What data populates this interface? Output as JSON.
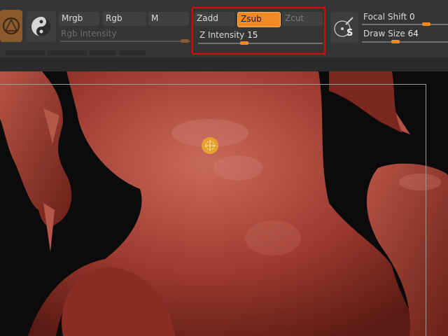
{
  "toolbar": {
    "rgb_mode_buttons": [
      "Mrgb",
      "Rgb",
      "M"
    ],
    "rgb_intensity_label": "Rgb Intensity",
    "zmode_buttons": {
      "zadd": "Zadd",
      "zsub": "Zsub",
      "zcut": "Zcut"
    },
    "active_zmode": "Zsub",
    "z_intensity": {
      "label": "Z Intensity",
      "value": "15"
    },
    "focal_shift": {
      "label": "Focal Shift",
      "value": "0"
    },
    "draw_size": {
      "label": "Draw Size",
      "value": "64"
    },
    "draw_icon_letter": "S"
  },
  "colors": {
    "accent": "#f28a23",
    "highlight_rect": "#e00000",
    "sculpt_clay": "#9e3a30"
  },
  "icons": [
    "material-sphere-icon",
    "stroke-s-icon",
    "draw-size-dynamics-icon"
  ]
}
